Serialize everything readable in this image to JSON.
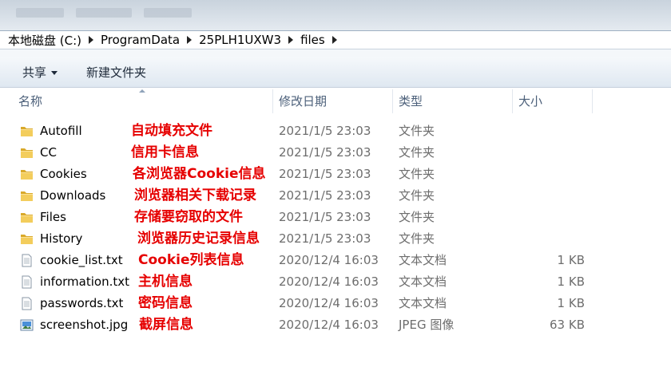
{
  "breadcrumb": [
    "本地磁盘 (C:)",
    "ProgramData",
    "25PLH1UXW3",
    "files"
  ],
  "toolbar": {
    "share_label": "共享",
    "new_folder_label": "新建文件夹"
  },
  "columns": {
    "name": "名称",
    "date": "修改日期",
    "type": "类型",
    "size": "大小"
  },
  "files": [
    {
      "icon": "folder-icon",
      "name": "Autofill",
      "date": "2021/1/5 23:03",
      "type": "文件夹",
      "size": "",
      "note": "自动填充文件"
    },
    {
      "icon": "folder-icon",
      "name": "CC",
      "date": "2021/1/5 23:03",
      "type": "文件夹",
      "size": "",
      "note": "信用卡信息"
    },
    {
      "icon": "folder-icon",
      "name": "Cookies",
      "date": "2021/1/5 23:03",
      "type": "文件夹",
      "size": "",
      "note": "各浏览器Cookie信息"
    },
    {
      "icon": "folder-icon",
      "name": "Downloads",
      "date": "2021/1/5 23:03",
      "type": "文件夹",
      "size": "",
      "note": "浏览器相关下载记录"
    },
    {
      "icon": "folder-icon",
      "name": "Files",
      "date": "2021/1/5 23:03",
      "type": "文件夹",
      "size": "",
      "note": "存储要窃取的文件"
    },
    {
      "icon": "folder-icon",
      "name": "History",
      "date": "2021/1/5 23:03",
      "type": "文件夹",
      "size": "",
      "note": "浏览器历史记录信息"
    },
    {
      "icon": "text-file-icon",
      "name": "cookie_list.txt",
      "date": "2020/12/4 16:03",
      "type": "文本文档",
      "size": "1 KB",
      "note": "Cookie列表信息"
    },
    {
      "icon": "text-file-icon",
      "name": "information.txt",
      "date": "2020/12/4 16:03",
      "type": "文本文档",
      "size": "1 KB",
      "note": "主机信息"
    },
    {
      "icon": "text-file-icon",
      "name": "passwords.txt",
      "date": "2020/12/4 16:03",
      "type": "文本文档",
      "size": "1 KB",
      "note": "密码信息"
    },
    {
      "icon": "image-file-icon",
      "name": "screenshot.jpg",
      "date": "2020/12/4 16:03",
      "type": "JPEG 图像",
      "size": "63 KB",
      "note": "截屏信息"
    }
  ]
}
